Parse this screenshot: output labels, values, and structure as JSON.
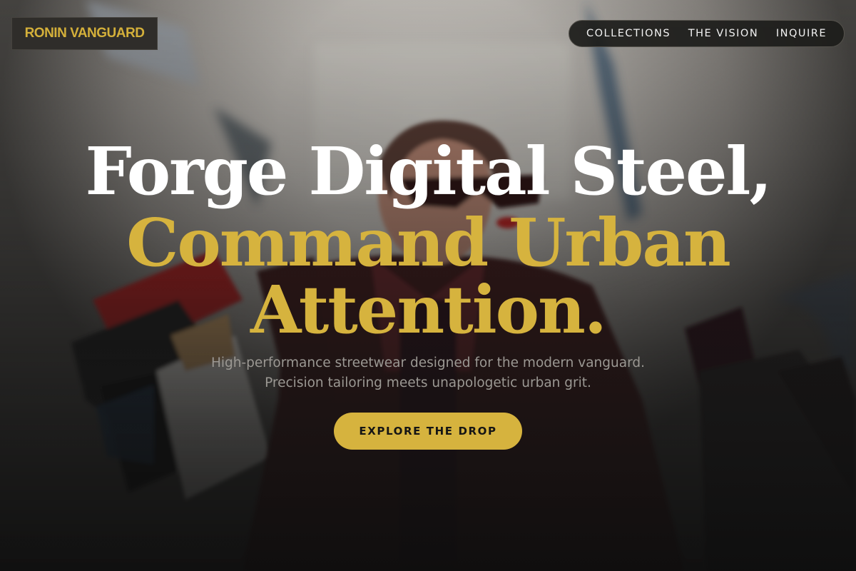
{
  "brand": {
    "name": "RONIN VANGUARD",
    "accent_color": "#d6b33e"
  },
  "nav": {
    "items": [
      {
        "label": "COLLECTIONS"
      },
      {
        "label": "THE VISION"
      },
      {
        "label": "INQUIRE"
      }
    ]
  },
  "hero": {
    "headline_line1": "Forge Digital Steel,",
    "headline_line2": "Command Urban",
    "headline_line3": "Attention.",
    "subcopy_line1": "High-performance streetwear designed for the modern vanguard.",
    "subcopy_line2": "Precision tailoring meets unapologetic urban grit.",
    "cta_label": "EXPLORE THE DROP"
  },
  "colors": {
    "headline_primary": "#ffffff",
    "headline_accent": "#d6b33e",
    "subcopy": "#9b9893",
    "nav_bg": "#1c1c1a"
  }
}
